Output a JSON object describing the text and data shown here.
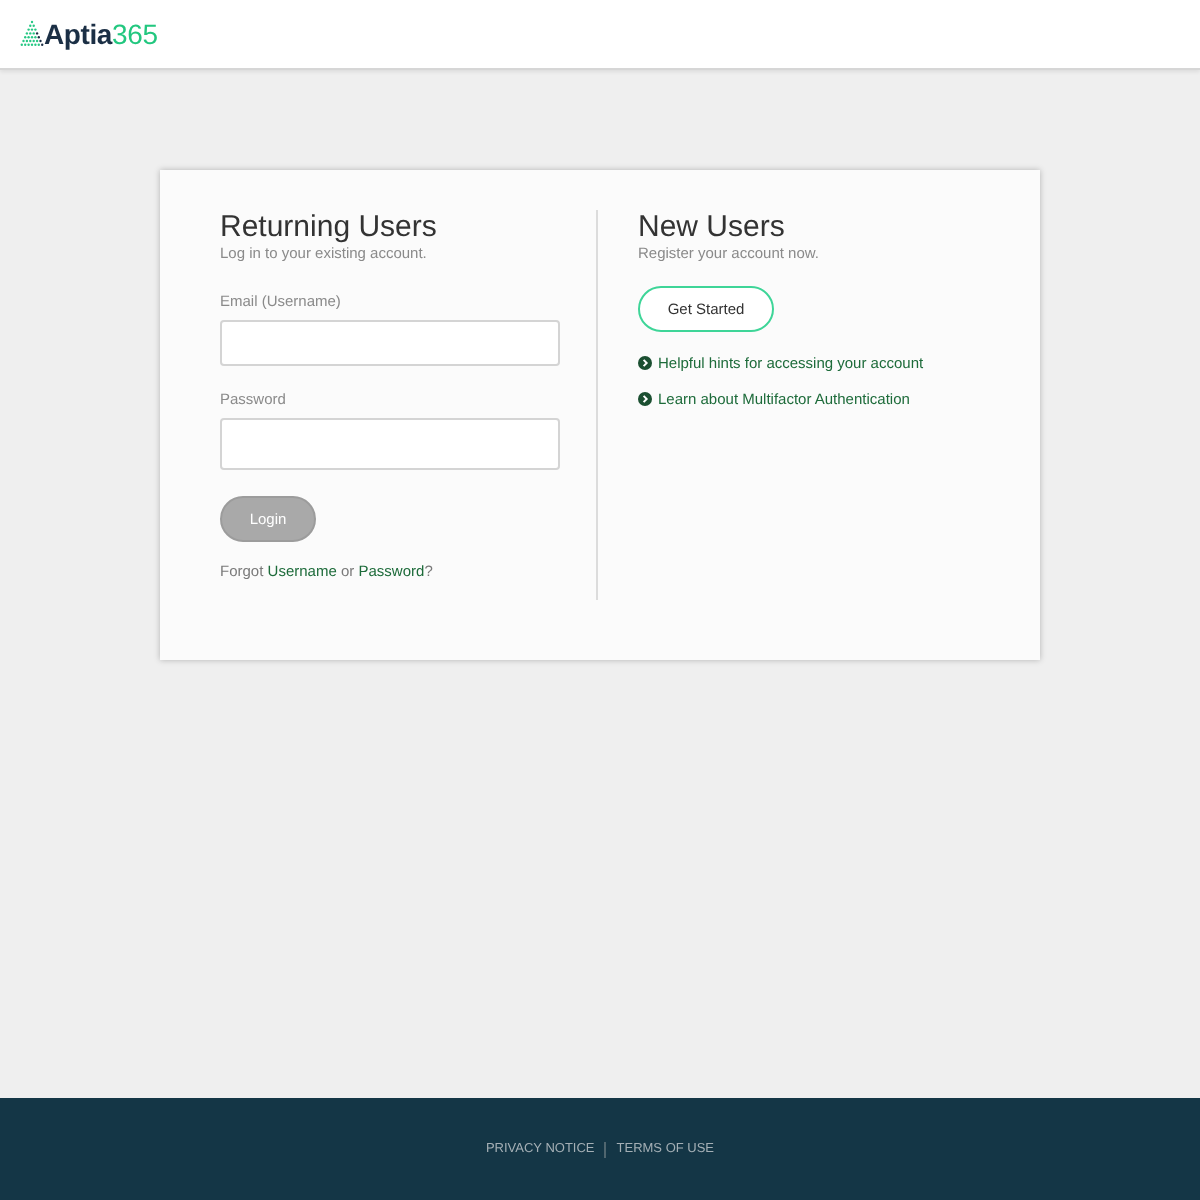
{
  "header": {
    "logo": {
      "name": "Aptia",
      "number": "365"
    }
  },
  "returning_users": {
    "title": "Returning Users",
    "subtitle": "Log in to your existing account.",
    "fields": [
      {
        "kind": "text",
        "label": "Email (Username)"
      },
      {
        "kind": "password",
        "label": "Password"
      }
    ],
    "login_button": {
      "label": "Login",
      "disabled": true
    },
    "forgot": {
      "before": "Forgot",
      "username_link": "Username",
      "middle": "or",
      "password_link": "Password",
      "after": "?"
    }
  },
  "new_users": {
    "title": "New Users",
    "subtitle": "Register your account now.",
    "button": "Get Started",
    "links": [
      "Helpful hints for accessing your account",
      "Learn about Multifactor Authentication"
    ]
  },
  "footer": {
    "links": [
      "PRIVACY NOTICE",
      "TERMS OF USE"
    ]
  }
}
